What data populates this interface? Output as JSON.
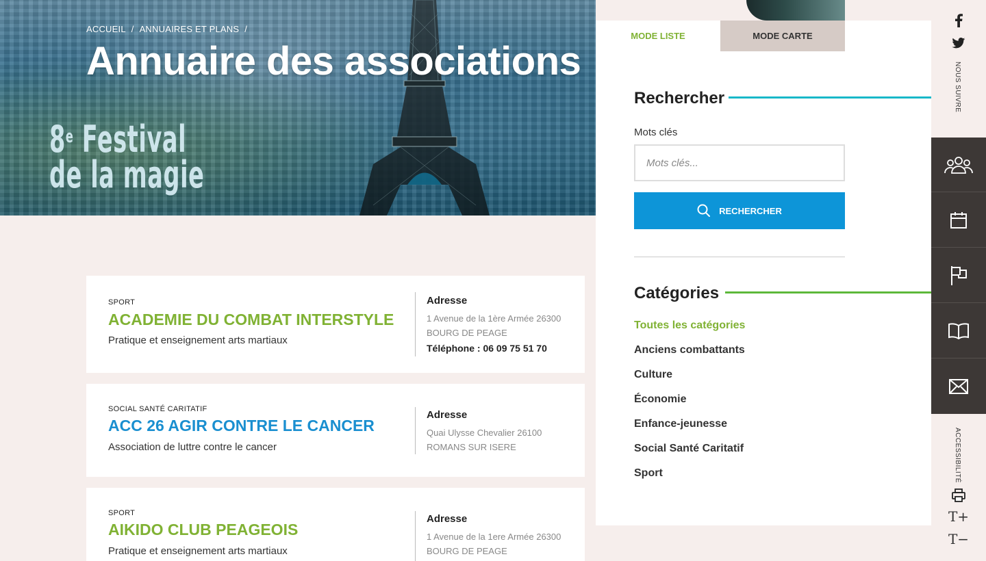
{
  "breadcrumb": {
    "items": [
      "ACCUEIL",
      "ANNUAIRES ET PLANS"
    ],
    "separator": "/"
  },
  "page_title": "Annuaire des associations",
  "hero_banner": {
    "line1_ordinal": "8",
    "line1_sup": "e",
    "line1_rest": " Festival",
    "line2": "de la magie"
  },
  "colors": {
    "accent_green": "#80b234",
    "accent_blue": "#0d95d8",
    "teal_rule": "#18b8c8",
    "dock_bg": "#3d3836"
  },
  "associations": [
    {
      "category": "SPORT",
      "name": "ACADEMIE DU COMBAT INTERSTYLE",
      "name_color": "#80b234",
      "description": "Pratique et enseignement arts martiaux",
      "address_title": "Adresse",
      "address_line1": "1 Avenue de la 1ère Armée 26300",
      "address_line2": "BOURG DE PEAGE",
      "phone": "Téléphone : 06 09 75 51 70"
    },
    {
      "category": "SOCIAL SANTÉ CARITATIF",
      "name": "ACC 26 AGIR CONTRE LE CANCER",
      "name_color": "#1a8fd0",
      "description": "Association de luttre contre le cancer",
      "address_title": "Adresse",
      "address_line1": "Quai Ulysse Chevalier 26100",
      "address_line2": "ROMANS SUR ISERE"
    },
    {
      "category": "SPORT",
      "name": "AIKIDO CLUB PEAGEOIS",
      "name_color": "#80b234",
      "description": "Pratique et enseignement arts martiaux",
      "address_title": "Adresse",
      "address_line1": "1 Avenue de la 1ere Armée 26300",
      "address_line2": "BOURG DE PEAGE"
    }
  ],
  "panel": {
    "tabs": {
      "list": "MODE LISTE",
      "map": "MODE CARTE"
    },
    "search": {
      "title": "Rechercher",
      "field_label": "Mots clés",
      "placeholder": "Mots clés...",
      "button": "RECHERCHER"
    },
    "categories": {
      "title": "Catégories",
      "items": [
        "Toutes les catégories",
        "Anciens combattants",
        "Culture",
        "Économie",
        "Enfance-jeunesse",
        "Social Santé Caritatif",
        "Sport"
      ]
    }
  },
  "sidebar": {
    "follow_label": "NOUS SUIVRE",
    "accessibility_label": "ACCESSIBILITÉ",
    "social_icons": [
      "facebook-icon",
      "twitter-icon"
    ],
    "dock_icons": [
      "people-icon",
      "calendar-icon",
      "flag-icon",
      "book-icon",
      "mail-icon"
    ],
    "tool_icons": [
      "print-icon",
      "text-increase-icon",
      "text-decrease-icon"
    ],
    "text_increase": "T+",
    "text_decrease": "T−"
  }
}
